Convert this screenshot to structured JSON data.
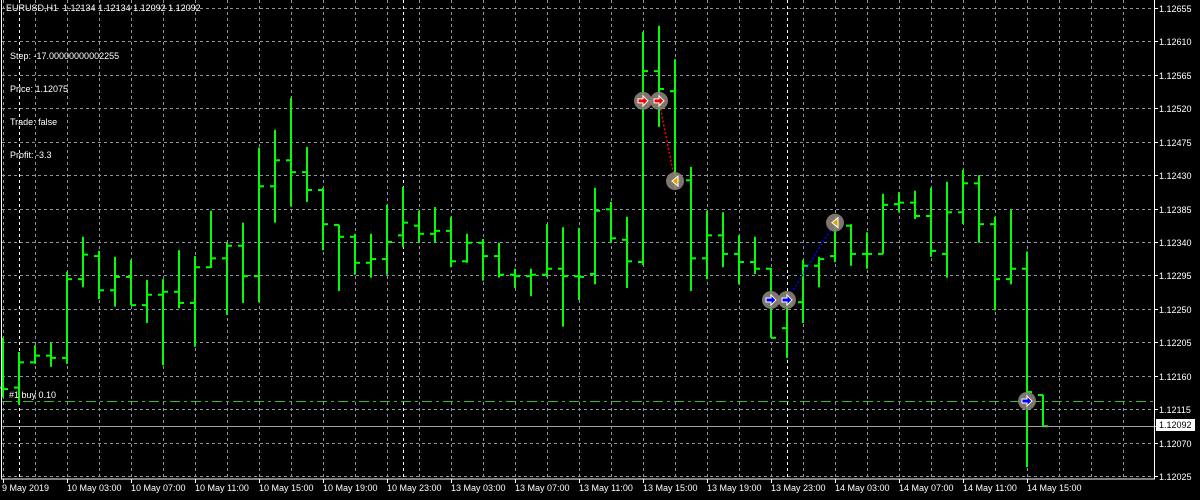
{
  "header": {
    "symbol_timeframe": "EURUSD,H1",
    "ohlc": "1.12134 1.12134 1.12092 1.12092"
  },
  "info_lines": [
    "Step: -17.00000000002255",
    "Price: 1.12075",
    "Trade: false",
    "Profit: -3.3"
  ],
  "order_line": {
    "label": "#1 buy 0.10",
    "price": 1.12126
  },
  "current_price": {
    "label": "1.12092",
    "value": 1.12092
  },
  "colors": {
    "background": "#000000",
    "bars": "#00ff00",
    "grid": "#8c96a0",
    "sell_arrow": "#ff0000",
    "buy_arrow": "#0000ff",
    "close_marker": "#e0a000",
    "marker_bg": "#8c8278"
  },
  "chart_data": {
    "type": "ohlc",
    "symbol": "EURUSD",
    "timeframe": "H1",
    "ylim": [
      1.12025,
      1.12655
    ],
    "price_ticks": [
      "1.12655",
      "1.12610",
      "1.12565",
      "1.12520",
      "1.12475",
      "1.12430",
      "1.12385",
      "1.12340",
      "1.12295",
      "1.12250",
      "1.12205",
      "1.12160",
      "1.12115",
      "1.12070",
      "1.12025"
    ],
    "time_labels": [
      "9 May 2019",
      "10 May 03:00",
      "10 May 07:00",
      "10 May 11:00",
      "10 May 15:00",
      "10 May 19:00",
      "10 May 23:00",
      "13 May 03:00",
      "13 May 07:00",
      "13 May 11:00",
      "13 May 15:00",
      "13 May 19:00",
      "13 May 23:00",
      "14 May 03:00",
      "14 May 07:00",
      "14 May 11:00",
      "14 May 15:00"
    ],
    "day_separator_bars": [
      1,
      25,
      49
    ],
    "bars": [
      [
        1.12144,
        1.12211,
        1.12131,
        1.12142
      ],
      [
        1.12144,
        1.12192,
        1.12121,
        1.12178
      ],
      [
        1.12178,
        1.12201,
        1.12176,
        1.12187
      ],
      [
        1.12187,
        1.12204,
        1.12172,
        1.12184
      ],
      [
        1.12184,
        1.123,
        1.12176,
        1.1229
      ],
      [
        1.1229,
        1.12347,
        1.12279,
        1.12323
      ],
      [
        1.12321,
        1.12328,
        1.12263,
        1.12275
      ],
      [
        1.12275,
        1.1232,
        1.12253,
        1.12293
      ],
      [
        1.12293,
        1.12316,
        1.12255,
        1.12255
      ],
      [
        1.12255,
        1.12289,
        1.12231,
        1.12269
      ],
      [
        1.12269,
        1.1229,
        1.12174,
        1.12273
      ],
      [
        1.12273,
        1.12329,
        1.12251,
        1.12258
      ],
      [
        1.12258,
        1.12321,
        1.12199,
        1.12306
      ],
      [
        1.12306,
        1.12382,
        1.12305,
        1.12318
      ],
      [
        1.12318,
        1.12339,
        1.12242,
        1.12335
      ],
      [
        1.12335,
        1.12366,
        1.12258,
        1.12294
      ],
      [
        1.12294,
        1.12467,
        1.12259,
        1.12415
      ],
      [
        1.12415,
        1.12491,
        1.12366,
        1.1245
      ],
      [
        1.1245,
        1.12534,
        1.12388,
        1.12434
      ],
      [
        1.12434,
        1.12468,
        1.12394,
        1.1241
      ],
      [
        1.1241,
        1.12413,
        1.12329,
        1.12364
      ],
      [
        1.12363,
        1.12363,
        1.12274,
        1.12347
      ],
      [
        1.12347,
        1.12351,
        1.12296,
        1.12312
      ],
      [
        1.12312,
        1.12351,
        1.12292,
        1.12317
      ],
      [
        1.12317,
        1.1239,
        1.12296,
        1.1234
      ],
      [
        1.12349,
        1.12414,
        1.12333,
        1.12366
      ],
      [
        1.12362,
        1.12382,
        1.12339,
        1.12351
      ],
      [
        1.12351,
        1.12387,
        1.12339,
        1.12355
      ],
      [
        1.12355,
        1.12374,
        1.12306,
        1.12314
      ],
      [
        1.12314,
        1.12351,
        1.12312,
        1.12339
      ],
      [
        1.12339,
        1.12344,
        1.12288,
        1.12321
      ],
      [
        1.12321,
        1.12339,
        1.12292,
        1.12296
      ],
      [
        1.12296,
        1.12304,
        1.12278,
        1.12294
      ],
      [
        1.12294,
        1.12304,
        1.12267,
        1.12296
      ],
      [
        1.12296,
        1.12364,
        1.12293,
        1.12304
      ],
      [
        1.12304,
        1.1236,
        1.12226,
        1.12294
      ],
      [
        1.12294,
        1.12359,
        1.12262,
        1.12293
      ],
      [
        1.12297,
        1.12413,
        1.12283,
        1.12382
      ],
      [
        1.12384,
        1.12394,
        1.12339,
        1.12345
      ],
      [
        1.12343,
        1.12374,
        1.12278,
        1.12314
      ],
      [
        1.12313,
        1.12623,
        1.12309,
        1.1257
      ],
      [
        1.1257,
        1.12631,
        1.12495,
        1.12546
      ],
      [
        1.12543,
        1.12586,
        1.12413,
        1.12423
      ],
      [
        1.12423,
        1.12441,
        1.12274,
        1.12318
      ],
      [
        1.12318,
        1.12382,
        1.1229,
        1.12349
      ],
      [
        1.12349,
        1.1238,
        1.12306,
        1.12324
      ],
      [
        1.12324,
        1.12349,
        1.12283,
        1.12313
      ],
      [
        1.12313,
        1.12347,
        1.12297,
        1.12304
      ],
      [
        1.12304,
        1.12305,
        1.12211,
        1.12211
      ],
      [
        1.12224,
        1.12273,
        1.12184,
        1.12257
      ],
      [
        1.12259,
        1.12316,
        1.12231,
        1.12308
      ],
      [
        1.12308,
        1.1232,
        1.12279,
        1.12317
      ],
      [
        1.12321,
        1.12367,
        1.12313,
        1.12364
      ],
      [
        1.12362,
        1.12364,
        1.12308,
        1.12324
      ],
      [
        1.12324,
        1.12353,
        1.12304,
        1.12324
      ],
      [
        1.12324,
        1.12405,
        1.12324,
        1.1239
      ],
      [
        1.12391,
        1.12407,
        1.1238,
        1.12393
      ],
      [
        1.12393,
        1.12409,
        1.12371,
        1.12375
      ],
      [
        1.12375,
        1.12413,
        1.1232,
        1.12328
      ],
      [
        1.12324,
        1.12421,
        1.12292,
        1.1238
      ],
      [
        1.1238,
        1.12437,
        1.12364,
        1.12419
      ],
      [
        1.12419,
        1.1243,
        1.12339,
        1.12364
      ],
      [
        1.12364,
        1.12374,
        1.12248,
        1.1229
      ],
      [
        1.1229,
        1.12383,
        1.12283,
        1.12304
      ],
      [
        1.12304,
        1.12327,
        1.12037,
        1.12138
      ],
      [
        1.12134,
        1.12134,
        1.12092,
        1.12092
      ]
    ],
    "trade_markers": [
      {
        "type": "sell-entry",
        "bar": 40,
        "price": 1.1253
      },
      {
        "type": "sell-entry",
        "bar": 41,
        "price": 1.1253
      },
      {
        "type": "close",
        "bar": 42,
        "price": 1.12422
      },
      {
        "type": "buy-entry",
        "bar": 48,
        "price": 1.12262
      },
      {
        "type": "buy-entry",
        "bar": 49,
        "price": 1.12262
      },
      {
        "type": "close",
        "bar": 52,
        "price": 1.12366
      },
      {
        "type": "buy-entry",
        "bar": 64,
        "price": 1.12126
      }
    ],
    "trade_links": [
      {
        "from": 1,
        "to": 2,
        "color": "sell"
      },
      {
        "from": 4,
        "to": 5,
        "color": "buy"
      }
    ]
  }
}
